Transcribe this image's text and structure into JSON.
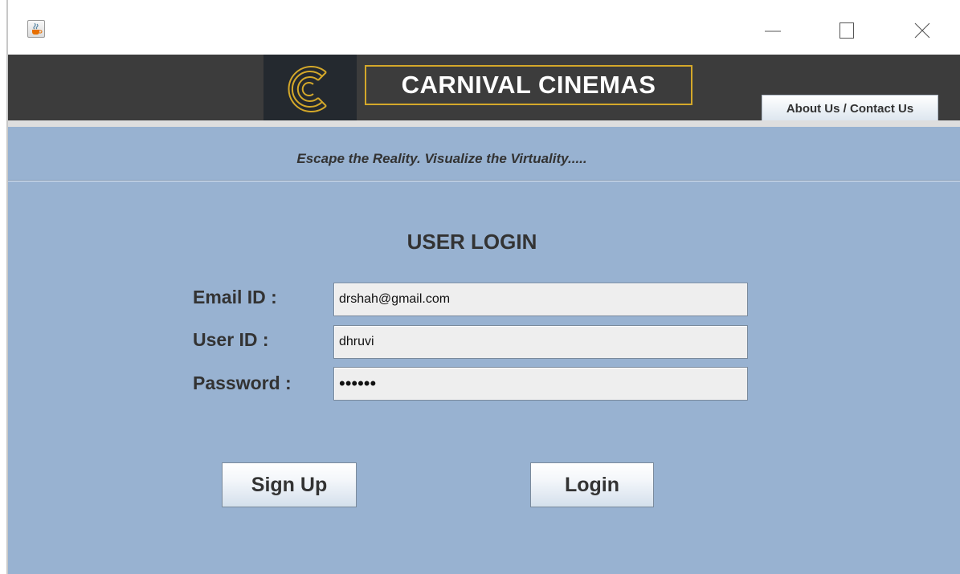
{
  "window": {
    "icon": "java-cup-icon",
    "controls": [
      "minimize-icon",
      "maximize-icon",
      "close-icon"
    ]
  },
  "header": {
    "logo": "cinema-c-logo",
    "brand": "CARNIVAL CINEMAS",
    "about_tab": "About Us / Contact Us"
  },
  "tagline": "Escape the Reality. Visualize the Virtuality.....",
  "form": {
    "title": "USER LOGIN",
    "email_label": "Email ID :",
    "email_value": "drshah@gmail.com",
    "userid_label": "User ID :",
    "userid_value": "dhruvi",
    "password_label": "Password :",
    "password_value": "••••••",
    "signup_label": "Sign Up",
    "login_label": "Login"
  },
  "colors": {
    "header_bg": "#3c3c3c",
    "brand_border": "#d4a82a",
    "main_bg": "#98b2d1",
    "text": "#333333"
  }
}
